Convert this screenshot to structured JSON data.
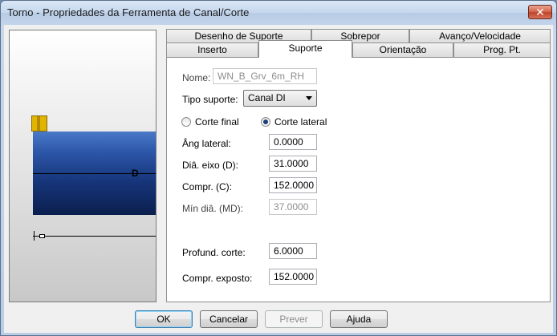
{
  "window": {
    "title": "Torno - Propriedades da Ferramenta de Canal/Corte",
    "close_glyph": "✕"
  },
  "tabs": {
    "row_back": [
      "Desenho de Suporte",
      "Sobrepor",
      "Avanço/Velocidade"
    ],
    "row_front": [
      "Inserto",
      "Suporte",
      "Orientação",
      "Prog. Pt."
    ],
    "active": "Suporte"
  },
  "form": {
    "name_label": "Nome:",
    "name_value": "WN_B_Grv_6m_RH",
    "holder_type_label": "Tipo suporte:",
    "holder_type_value": "Canal DI",
    "radio_face": "Corte final",
    "radio_side": "Corte lateral",
    "radio_selected": "Corte lateral",
    "side_angle_label": "Âng lateral:",
    "side_angle_value": "0.0000",
    "shank_dia_label": "Diâ. eixo (D):",
    "shank_dia_value": "31.0000",
    "length_label": "Compr. (C):",
    "length_value": "152.0000",
    "min_dia_label": "Mín diâ. (MD):",
    "min_dia_value": "37.0000",
    "cut_depth_label": "Profund. corte:",
    "cut_depth_value": "6.0000",
    "exposed_len_label": "Compr. exposto:",
    "exposed_len_value": "152.0000"
  },
  "preview": {
    "dimension_label": "D"
  },
  "buttons": {
    "ok": "OK",
    "cancel": "Cancelar",
    "preview": "Prever",
    "help": "Ajuda"
  }
}
